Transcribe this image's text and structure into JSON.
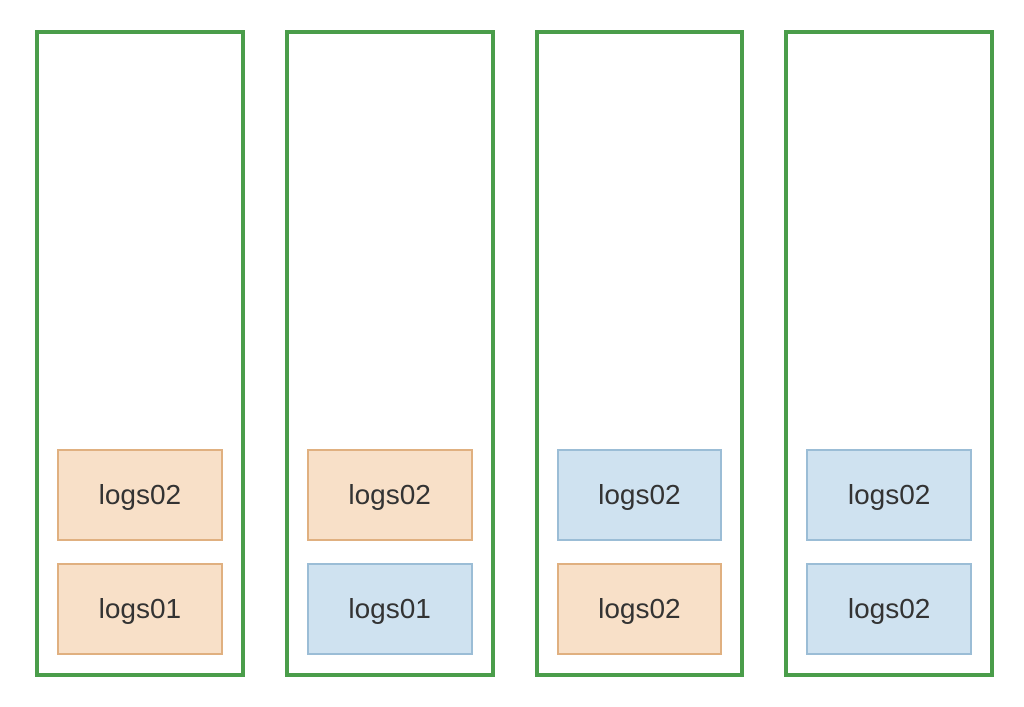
{
  "colors": {
    "column_border": "#4a9d4a",
    "shard_orange_fill": "#f8e0c8",
    "shard_orange_border": "#e0b080",
    "shard_blue_fill": "#cfe2f0",
    "shard_blue_border": "#9bbdd6"
  },
  "columns": [
    {
      "top": {
        "label": "logs02",
        "color": "orange"
      },
      "bottom": {
        "label": "logs01",
        "color": "orange"
      }
    },
    {
      "top": {
        "label": "logs02",
        "color": "orange"
      },
      "bottom": {
        "label": "logs01",
        "color": "blue"
      }
    },
    {
      "top": {
        "label": "logs02",
        "color": "blue"
      },
      "bottom": {
        "label": "logs02",
        "color": "orange"
      }
    },
    {
      "top": {
        "label": "logs02",
        "color": "blue"
      },
      "bottom": {
        "label": "logs02",
        "color": "blue"
      }
    }
  ]
}
